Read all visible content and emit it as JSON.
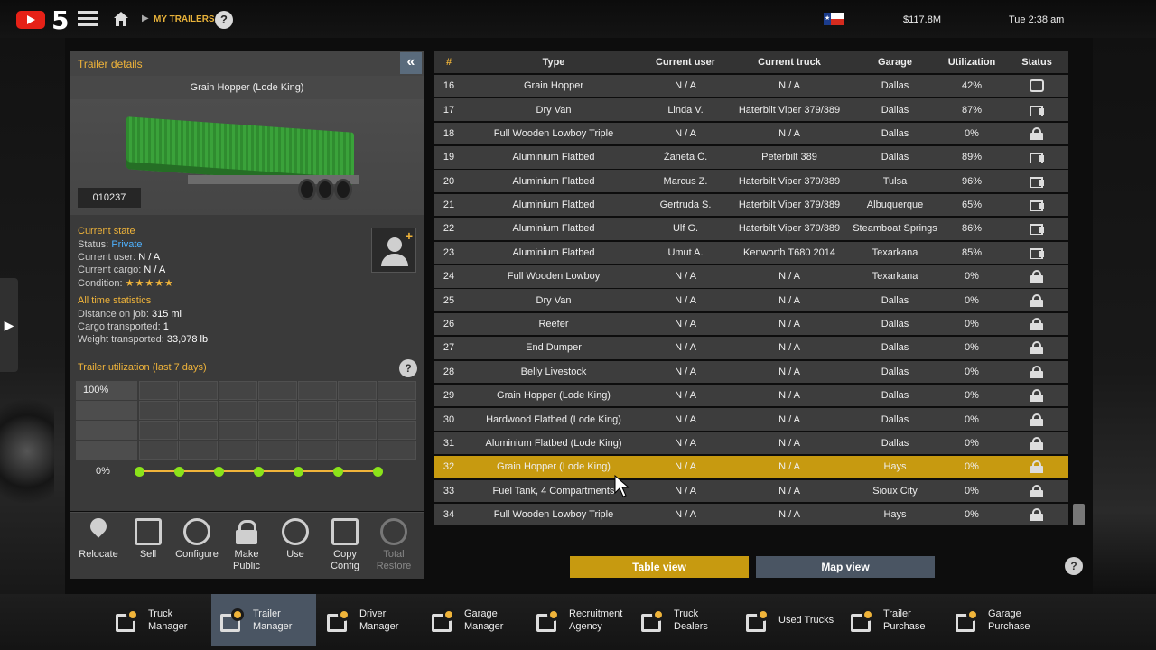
{
  "topbar": {
    "channel_number": "5",
    "breadcrumb": "MY TRAILERS",
    "help": "?",
    "money": "$117.8M",
    "time": "Tue 2:38 am"
  },
  "details": {
    "panel_title": "Trailer details",
    "collapse_glyph": "«",
    "trailer_name": "Grain Hopper (Lode King)",
    "trailer_id": "010237",
    "current_state_title": "Current state",
    "status_label": "Status:",
    "status_value": "Private",
    "user_label": "Current user:",
    "user_value": "N / A",
    "cargo_label": "Current cargo:",
    "cargo_value": "N / A",
    "condition_label": "Condition:",
    "condition_stars": "★★★★★",
    "condition_rating": 5,
    "stats_title": "All time statistics",
    "distance_label": "Distance on job:",
    "distance_value": "315 mi",
    "cargo_transported_label": "Cargo transported:",
    "cargo_transported_value": "1",
    "weight_label": "Weight transported:",
    "weight_value": "33,078 lb",
    "utilization_title": "Trailer utilization (last 7 days)",
    "y_max_label": "100%",
    "y_min_label": "0%",
    "utilization_values": [
      0,
      0,
      0,
      0,
      0,
      0,
      0
    ]
  },
  "actions": {
    "relocate": "Relocate",
    "sell": "Sell",
    "configure": "Configure",
    "make_public_1": "Make",
    "make_public_2": "Public",
    "use": "Use",
    "copy_config_1": "Copy",
    "copy_config_2": "Config",
    "total_restore_1": "Total",
    "total_restore_2": "Restore"
  },
  "table": {
    "headers": [
      "#",
      "Type",
      "Current user",
      "Current truck",
      "Garage",
      "Utilization",
      "Status"
    ],
    "selected_row": 32,
    "rows": [
      {
        "n": "16",
        "type": "Grain Hopper",
        "user": "N / A",
        "truck": "N / A",
        "garage": "Dallas",
        "util": "42%",
        "status": "trailer-icon"
      },
      {
        "n": "17",
        "type": "Dry Van",
        "user": "Linda V.",
        "truck": "Haterbilt Viper 379/389",
        "garage": "Dallas",
        "util": "87%",
        "status": "truck-icon"
      },
      {
        "n": "18",
        "type": "Full Wooden Lowboy Triple",
        "user": "N / A",
        "truck": "N / A",
        "garage": "Dallas",
        "util": "0%",
        "status": "lock-icon"
      },
      {
        "n": "19",
        "type": "Aluminium Flatbed",
        "user": "Žaneta Č.",
        "truck": "Peterbilt 389",
        "garage": "Dallas",
        "util": "89%",
        "status": "truck-icon"
      },
      {
        "n": "20",
        "type": "Aluminium Flatbed",
        "user": "Marcus Z.",
        "truck": "Haterbilt Viper 379/389",
        "garage": "Tulsa",
        "util": "96%",
        "status": "truck-icon"
      },
      {
        "n": "21",
        "type": "Aluminium Flatbed",
        "user": "Gertruda S.",
        "truck": "Haterbilt Viper 379/389",
        "garage": "Albuquerque",
        "util": "65%",
        "status": "truck-icon"
      },
      {
        "n": "22",
        "type": "Aluminium Flatbed",
        "user": "Ulf G.",
        "truck": "Haterbilt Viper 379/389",
        "garage": "Steamboat Springs",
        "util": "86%",
        "status": "truck-icon"
      },
      {
        "n": "23",
        "type": "Aluminium Flatbed",
        "user": "Umut A.",
        "truck": "Kenworth T680 2014",
        "garage": "Texarkana",
        "util": "85%",
        "status": "truck-icon"
      },
      {
        "n": "24",
        "type": "Full Wooden Lowboy",
        "user": "N / A",
        "truck": "N / A",
        "garage": "Texarkana",
        "util": "0%",
        "status": "lock-icon"
      },
      {
        "n": "25",
        "type": "Dry Van",
        "user": "N / A",
        "truck": "N / A",
        "garage": "Dallas",
        "util": "0%",
        "status": "lock-icon"
      },
      {
        "n": "26",
        "type": "Reefer",
        "user": "N / A",
        "truck": "N / A",
        "garage": "Dallas",
        "util": "0%",
        "status": "lock-icon"
      },
      {
        "n": "27",
        "type": "End Dumper",
        "user": "N / A",
        "truck": "N / A",
        "garage": "Dallas",
        "util": "0%",
        "status": "lock-icon"
      },
      {
        "n": "28",
        "type": "Belly Livestock",
        "user": "N / A",
        "truck": "N / A",
        "garage": "Dallas",
        "util": "0%",
        "status": "lock-icon"
      },
      {
        "n": "29",
        "type": "Grain Hopper (Lode King)",
        "user": "N / A",
        "truck": "N / A",
        "garage": "Dallas",
        "util": "0%",
        "status": "lock-icon"
      },
      {
        "n": "30",
        "type": "Hardwood Flatbed (Lode King)",
        "user": "N / A",
        "truck": "N / A",
        "garage": "Dallas",
        "util": "0%",
        "status": "lock-icon"
      },
      {
        "n": "31",
        "type": "Aluminium Flatbed (Lode King)",
        "user": "N / A",
        "truck": "N / A",
        "garage": "Dallas",
        "util": "0%",
        "status": "lock-icon"
      },
      {
        "n": "32",
        "type": "Grain Hopper (Lode King)",
        "user": "N / A",
        "truck": "N / A",
        "garage": "Hays",
        "util": "0%",
        "status": "lock-icon"
      },
      {
        "n": "33",
        "type": "Fuel Tank, 4 Compartments",
        "user": "N / A",
        "truck": "N / A",
        "garage": "Sioux City",
        "util": "0%",
        "status": "lock-icon"
      },
      {
        "n": "34",
        "type": "Full Wooden Lowboy Triple",
        "user": "N / A",
        "truck": "N / A",
        "garage": "Hays",
        "util": "0%",
        "status": "lock-icon"
      }
    ]
  },
  "views": {
    "table": "Table view",
    "map": "Map view",
    "help": "?"
  },
  "bottom_nav": [
    {
      "l1": "Truck",
      "l2": "Manager",
      "name": "truck-manager"
    },
    {
      "l1": "Trailer",
      "l2": "Manager",
      "name": "trailer-manager",
      "active": true
    },
    {
      "l1": "Driver",
      "l2": "Manager",
      "name": "driver-manager"
    },
    {
      "l1": "Garage",
      "l2": "Manager",
      "name": "garage-manager"
    },
    {
      "l1": "Recruitment",
      "l2": "Agency",
      "name": "recruitment-agency"
    },
    {
      "l1": "Truck",
      "l2": "Dealers",
      "name": "truck-dealers"
    },
    {
      "l1": "Used Trucks",
      "l2": "",
      "name": "used-trucks"
    },
    {
      "l1": "Trailer",
      "l2": "Purchase",
      "name": "trailer-purchase"
    },
    {
      "l1": "Garage",
      "l2": "Purchase",
      "name": "garage-purchase"
    }
  ],
  "colors": {
    "accent": "#f0b43a",
    "selected_row": "#c79a10",
    "status_private": "#4fb2ff",
    "utilization_dot": "#8be31a",
    "inactive_button": "#4a5563"
  }
}
